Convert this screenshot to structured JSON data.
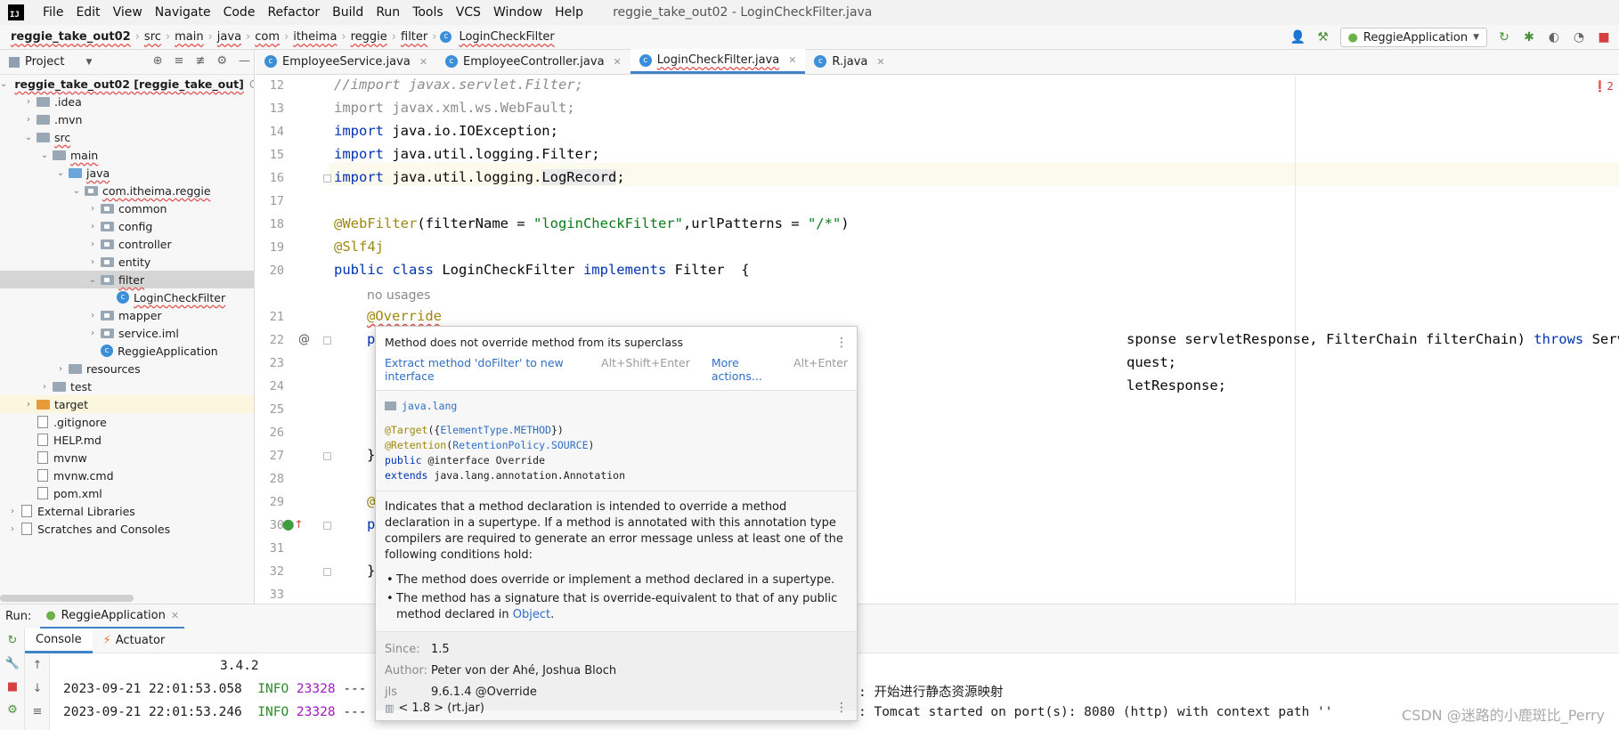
{
  "window_title": "reggie_take_out02 - LoginCheckFilter.java",
  "menu": [
    "File",
    "Edit",
    "View",
    "Navigate",
    "Code",
    "Refactor",
    "Build",
    "Run",
    "Tools",
    "VCS",
    "Window",
    "Help"
  ],
  "breadcrumb": [
    "reggie_take_out02",
    "src",
    "main",
    "java",
    "com",
    "itheima",
    "reggie",
    "filter",
    "LoginCheckFilter"
  ],
  "run_config": "ReggieApplication",
  "project_panel": {
    "title": "Project",
    "items": [
      {
        "label": "reggie_take_out02 [reggie_take_out]",
        "suffix": "C:\\U",
        "depth": 0,
        "arrow": "v",
        "icon": "folder-blue"
      },
      {
        "label": ".idea",
        "depth": 1,
        "arrow": ">",
        "icon": "folder"
      },
      {
        "label": ".mvn",
        "depth": 1,
        "arrow": ">",
        "icon": "folder"
      },
      {
        "label": "src",
        "depth": 1,
        "arrow": "v",
        "icon": "folder"
      },
      {
        "label": "main",
        "depth": 2,
        "arrow": "v",
        "icon": "folder"
      },
      {
        "label": "java",
        "depth": 3,
        "arrow": "v",
        "icon": "folder-blue"
      },
      {
        "label": "com.itheima.reggie",
        "depth": 4,
        "arrow": "v",
        "icon": "package"
      },
      {
        "label": "common",
        "depth": 5,
        "arrow": ">",
        "icon": "package"
      },
      {
        "label": "config",
        "depth": 5,
        "arrow": ">",
        "icon": "package"
      },
      {
        "label": "controller",
        "depth": 5,
        "arrow": ">",
        "icon": "package"
      },
      {
        "label": "entity",
        "depth": 5,
        "arrow": ">",
        "icon": "package"
      },
      {
        "label": "filter",
        "depth": 5,
        "arrow": "v",
        "icon": "package"
      },
      {
        "label": "LoginCheckFilter",
        "depth": 6,
        "arrow": "",
        "icon": "class"
      },
      {
        "label": "mapper",
        "depth": 5,
        "arrow": ">",
        "icon": "package"
      },
      {
        "label": "service.iml",
        "depth": 5,
        "arrow": ">",
        "icon": "package"
      },
      {
        "label": "ReggieApplication",
        "depth": 5,
        "arrow": "",
        "icon": "class"
      },
      {
        "label": "resources",
        "depth": 3,
        "arrow": ">",
        "icon": "folder"
      },
      {
        "label": "test",
        "depth": 2,
        "arrow": ">",
        "icon": "folder"
      },
      {
        "label": "target",
        "depth": 1,
        "arrow": ">",
        "icon": "folder-orange"
      },
      {
        "label": ".gitignore",
        "depth": 1,
        "arrow": "",
        "icon": "file"
      },
      {
        "label": "HELP.md",
        "depth": 1,
        "arrow": "",
        "icon": "file"
      },
      {
        "label": "mvnw",
        "depth": 1,
        "arrow": "",
        "icon": "file"
      },
      {
        "label": "mvnw.cmd",
        "depth": 1,
        "arrow": "",
        "icon": "file"
      },
      {
        "label": "pom.xml",
        "depth": 1,
        "arrow": "",
        "icon": "file"
      },
      {
        "label": "External Libraries",
        "depth": 0,
        "arrow": ">",
        "icon": "file"
      },
      {
        "label": "Scratches and Consoles",
        "depth": 0,
        "arrow": ">",
        "icon": "file"
      }
    ]
  },
  "editor_tabs": [
    {
      "label": "EmployeeService.java",
      "active": false
    },
    {
      "label": "EmployeeController.java",
      "active": false
    },
    {
      "label": "LoginCheckFilter.java",
      "active": true
    },
    {
      "label": "R.java",
      "active": false
    }
  ],
  "error_count": "2",
  "line_numbers": [
    "12",
    "13",
    "14",
    "15",
    "16",
    "17",
    "18",
    "19",
    "20",
    "",
    "21",
    "22",
    "23",
    "24",
    "25",
    "26",
    "27",
    "28",
    "29",
    "30",
    "31",
    "32",
    "33"
  ],
  "code": {
    "l12": "//import javax.servlet.Filter;",
    "l13": "import javax.xml.ws.WebFault;",
    "l14_kw": "import",
    "l14": " java.io.IOException;",
    "l15_kw": "import",
    "l15": " java.util.logging.Filter;",
    "l16_kw": "import",
    "l16": " java.util.logging.",
    "l16_b": "LogRecord",
    "l16_c": ";",
    "l18_ann": "@WebFilter",
    "l18_a": "(filterName = ",
    "l18_s1": "\"loginCheckFilter\"",
    "l18_b": ",urlPatterns = ",
    "l18_s2": "\"/*\"",
    "l18_c": ")",
    "l19_ann": "@Slf4j",
    "l20_kw1": "public class",
    "l20_a": " LoginCheckFilter ",
    "l20_kw2": "implements",
    "l20_b": " Filter  {",
    "hint": "no usages",
    "l21_ann": "@Override",
    "l22_p": "p",
    "l22_rest": "sponse servletResponse, FilterChain filterChain) ",
    "l22_kw": "throws",
    "l22_end": " ServletException, IOException {",
    "l23_rest": "quest;",
    "l24_rest": "letResponse;",
    "l27": "}",
    "l29": "@",
    "l30": "p",
    "l32": "}"
  },
  "popup": {
    "message": "Method does not override method from its superclass",
    "action": "Extract method 'doFilter' to new interface",
    "action_key": "Alt+Shift+Enter",
    "more": "More actions...",
    "more_key": "Alt+Enter",
    "package": "java.lang",
    "def1_ann": "@Target",
    "def1_a": "({",
    "def1_link": "ElementType.METHOD",
    "def1_b": "})",
    "def2_ann": "@Retention",
    "def2_a": "(",
    "def2_link": "RetentionPolicy.SOURCE",
    "def2_b": ")",
    "def3_kw": "public",
    "def3_rest": " @interface Override",
    "def4_kw": "extends",
    "def4_rest": " java.lang.annotation.Annotation",
    "description": "Indicates that a method declaration is intended to override a method declaration in a supertype. If a method is annotated with this annotation type compilers are required to generate an error message unless at least one of the following conditions hold:",
    "bullet1": "The method does override or implement a method declared in a supertype.",
    "bullet2_a": "The method has a signature that is override-equivalent to that of any public method declared in ",
    "bullet2_link": "Object",
    "bullet2_b": ".",
    "since_key": "Since:",
    "since_val": "1.5",
    "author_key": "Author:",
    "author_val": "Peter von der Ahé, Joshua Bloch",
    "jls_key": "jls",
    "jls_val": "9.6.1.4 @Override",
    "footer": "< 1.8 > (rt.jar)"
  },
  "run": {
    "label": "Run:",
    "tab": "ReggieApplication",
    "subtab_console": "Console",
    "subtab_actuator": "Actuator",
    "version": "3.4.2",
    "log1_time": "2023-09-21 22:01:53.058",
    "log1_level": "INFO",
    "log1_pid": "23328",
    "log1_sep": "---",
    "log1_msg": ": 开始进行静态资源映射",
    "log2_time": "2023-09-21 22:01:53.246",
    "log2_level": "INFO",
    "log2_pid": "23328",
    "log2_sep": "---",
    "log2_msg": ": Tomcat started on port(s): 8080 (http) with context path ''"
  },
  "watermark": "CSDN @迷路的小鹿斑比_Perry"
}
